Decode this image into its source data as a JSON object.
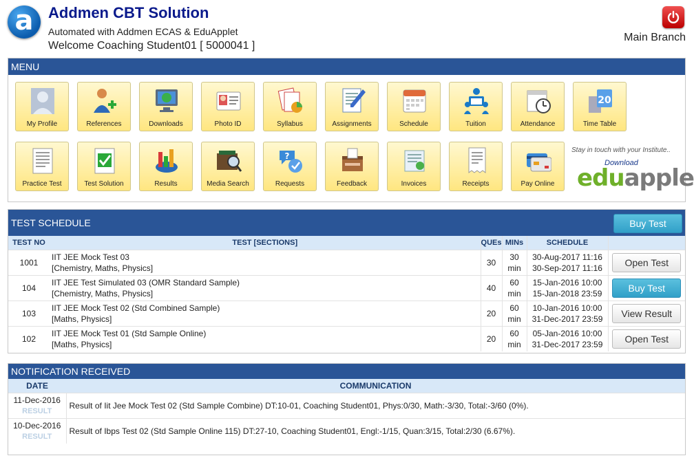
{
  "app": {
    "logo_letter": "a",
    "title": "Addmen CBT Solution",
    "subtitle": "Automated with Addmen ECAS & EduApplet",
    "welcome": "Welcome Coaching Student01 [ 5000041 ]",
    "branch": "Main Branch"
  },
  "menu": {
    "heading": "MENU",
    "items": [
      {
        "label": "My Profile",
        "icon": "profile-icon"
      },
      {
        "label": "References",
        "icon": "references-icon"
      },
      {
        "label": "Downloads",
        "icon": "downloads-icon"
      },
      {
        "label": "Photo ID",
        "icon": "photo-id-icon"
      },
      {
        "label": "Syllabus",
        "icon": "syllabus-icon"
      },
      {
        "label": "Assignments",
        "icon": "assignments-icon"
      },
      {
        "label": "Schedule",
        "icon": "schedule-icon"
      },
      {
        "label": "Tuition",
        "icon": "tuition-icon"
      },
      {
        "label": "Attendance",
        "icon": "attendance-icon"
      },
      {
        "label": "Time Table",
        "icon": "time-table-icon"
      },
      {
        "label": "Practice Test",
        "icon": "practice-test-icon"
      },
      {
        "label": "Test Solution",
        "icon": "test-solution-icon"
      },
      {
        "label": "Results",
        "icon": "results-icon"
      },
      {
        "label": "Media Search",
        "icon": "media-search-icon"
      },
      {
        "label": "Requests",
        "icon": "requests-icon"
      },
      {
        "label": "Feedback",
        "icon": "feedback-icon"
      },
      {
        "label": "Invoices",
        "icon": "invoices-icon"
      },
      {
        "label": "Receipts",
        "icon": "receipts-icon"
      },
      {
        "label": "Pay Online",
        "icon": "pay-online-icon"
      }
    ],
    "promo": {
      "tagline": "Stay in touch with your Institute..",
      "download": "Download",
      "brand_a": "edu",
      "brand_b": "applet"
    }
  },
  "tests": {
    "heading": "TEST SCHEDULE",
    "buy_button": "Buy Test",
    "columns": [
      "TEST NO",
      "TEST [SECTIONS]",
      "QUEs",
      "MINs",
      "SCHEDULE",
      ""
    ],
    "rows": [
      {
        "no": "1001",
        "name": "IIT JEE Mock Test 03",
        "sections": "[Chemistry, Maths, Physics]",
        "ques": "30",
        "mins": "30",
        "unit": "min",
        "start": "30-Aug-2017 11:16",
        "end": "30-Sep-2017 11:16",
        "action": "Open Test",
        "style": "default"
      },
      {
        "no": "104",
        "name": "IIT JEE Test Simulated 03 (OMR Standard Sample)",
        "sections": "[Chemistry, Maths, Physics]",
        "ques": "40",
        "mins": "60",
        "unit": "min",
        "start": "15-Jan-2016 10:00",
        "end": "15-Jan-2018 23:59",
        "action": "Buy Test",
        "style": "info"
      },
      {
        "no": "103",
        "name": "IIT JEE Mock Test 02 (Std Combined Sample)",
        "sections": "[Maths, Physics]",
        "ques": "20",
        "mins": "60",
        "unit": "min",
        "start": "10-Jan-2016 10:00",
        "end": "31-Dec-2017 23:59",
        "action": "View Result",
        "style": "default"
      },
      {
        "no": "102",
        "name": "IIT JEE Mock Test 01 (Std Sample Online)",
        "sections": "[Maths, Physics]",
        "ques": "20",
        "mins": "60",
        "unit": "min",
        "start": "05-Jan-2016 10:00",
        "end": "31-Dec-2017 23:59",
        "action": "Open Test",
        "style": "default"
      }
    ]
  },
  "notifications": {
    "heading": "NOTIFICATION RECEIVED",
    "columns": [
      "DATE",
      "COMMUNICATION"
    ],
    "rows": [
      {
        "date": "11-Dec-2016",
        "type": "RESULT",
        "message": "Result of Iit Jee Mock Test 02 (Std Sample Combine) DT:10-01, Coaching Student01, Phys:0/30, Math:-3/30, Total:-3/60 (0%)."
      },
      {
        "date": "10-Dec-2016",
        "type": "RESULT",
        "message": "Result of Ibps Test 02 (Std Sample Online 115) DT:27-10, Coaching Student01, Engl:-1/15, Quan:3/15, Total:2/30 (6.67%)."
      }
    ]
  }
}
